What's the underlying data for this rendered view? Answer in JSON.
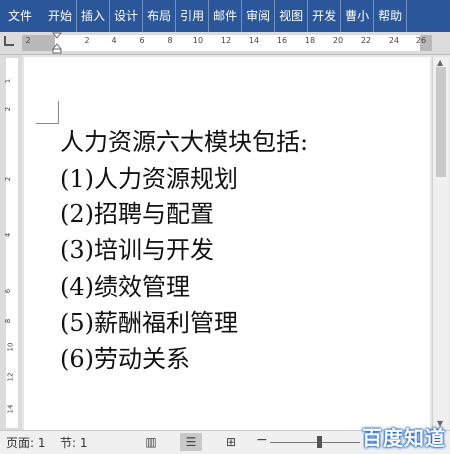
{
  "ribbon": {
    "file_tab": "文件",
    "tabs": [
      "开始",
      "插入",
      "设计",
      "布局",
      "引用",
      "邮件",
      "审阅",
      "视图",
      "开发",
      "曹小",
      "帮助"
    ]
  },
  "ruler": {
    "h_numbers": [
      "2",
      "2",
      "4",
      "6",
      "8",
      "10",
      "12",
      "14",
      "16",
      "18",
      "20",
      "22",
      "24",
      "26"
    ],
    "v_numbers": [
      "1",
      "2",
      "2",
      "4",
      "6",
      "8",
      "10",
      "12",
      "14"
    ]
  },
  "document": {
    "lines": [
      "人力资源六大模块包括:",
      "(1)人力资源规划",
      "(2)招聘与配置",
      "(3)培训与开发",
      "(4)绩效管理",
      "(5)薪酬福利管理",
      "(6)劳动关系"
    ]
  },
  "status": {
    "page": "页面: 1",
    "section": "节: 1",
    "zoom_minus": "−",
    "zoom_fraction": 0.5
  },
  "watermark": {
    "text": "百度知道"
  },
  "icons": {
    "read_mode": "book-icon",
    "print_layout": "page-icon",
    "web_layout": "web-icon"
  }
}
